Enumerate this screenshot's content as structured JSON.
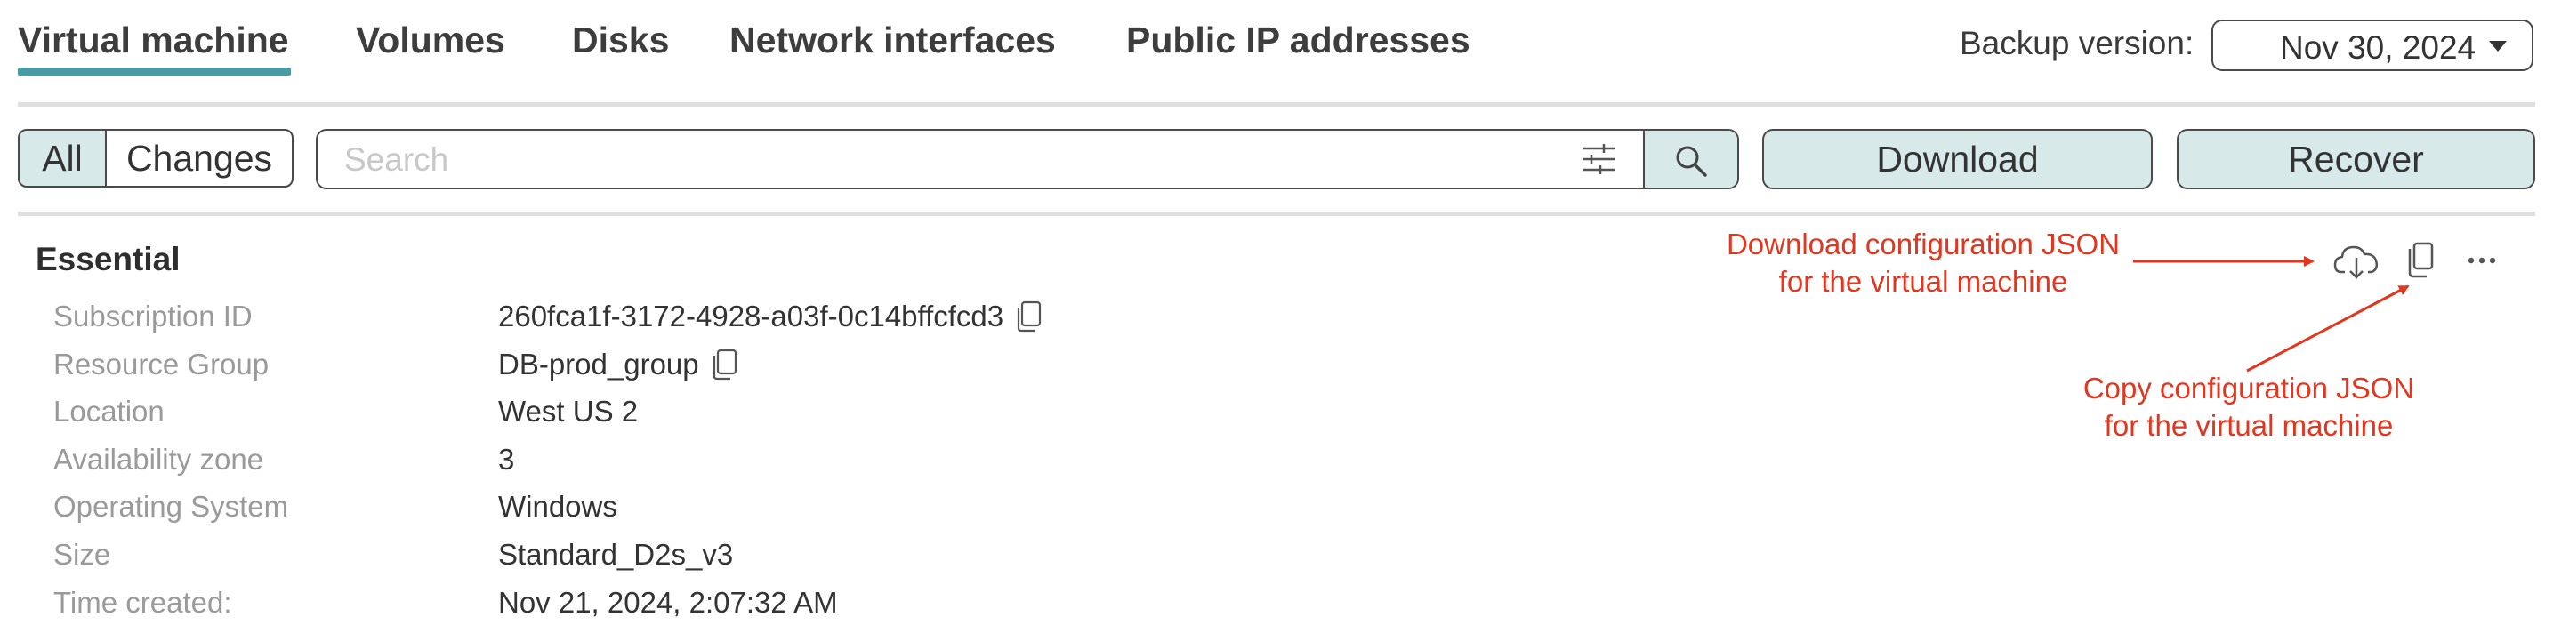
{
  "tabs": {
    "virtual_machine": "Virtual machine",
    "volumes": "Volumes",
    "disks": "Disks",
    "network_interfaces": "Network interfaces",
    "public_ip": "Public IP addresses"
  },
  "backup": {
    "label": "Backup version:",
    "value": "Nov 30, 2024"
  },
  "toolbar": {
    "all": "All",
    "changes": "Changes",
    "search_placeholder": "Search",
    "download": "Download",
    "recover": "Recover"
  },
  "essential": {
    "title": "Essential",
    "rows": [
      {
        "label": "Subscription ID",
        "value": "260fca1f-3172-4928-a03f-0c14bffcfcd3"
      },
      {
        "label": "Resource Group",
        "value": "DB-prod_group"
      },
      {
        "label": "Location",
        "value": "West US 2"
      },
      {
        "label": "Availability zone",
        "value": "3"
      },
      {
        "label": "Operating System",
        "value": "Windows"
      },
      {
        "label": "Size",
        "value": "Standard_D2s_v3"
      },
      {
        "label": "Time created:",
        "value": "Nov 21, 2024, 2:07:32 AM"
      }
    ]
  },
  "annotations": {
    "download_line1": "Download configuration JSON",
    "download_line2": "for the virtual machine",
    "copy_line1": "Copy configuration JSON",
    "copy_line2": "for the virtual machine"
  },
  "colors": {
    "accent": "#4a9aa2",
    "button_bg": "#d8e9ea",
    "annotation": "#e2361f"
  },
  "icons": [
    "search-icon",
    "filter-icon",
    "cloud-download-icon",
    "copy-icon",
    "more-icon",
    "chevron-down-icon"
  ]
}
